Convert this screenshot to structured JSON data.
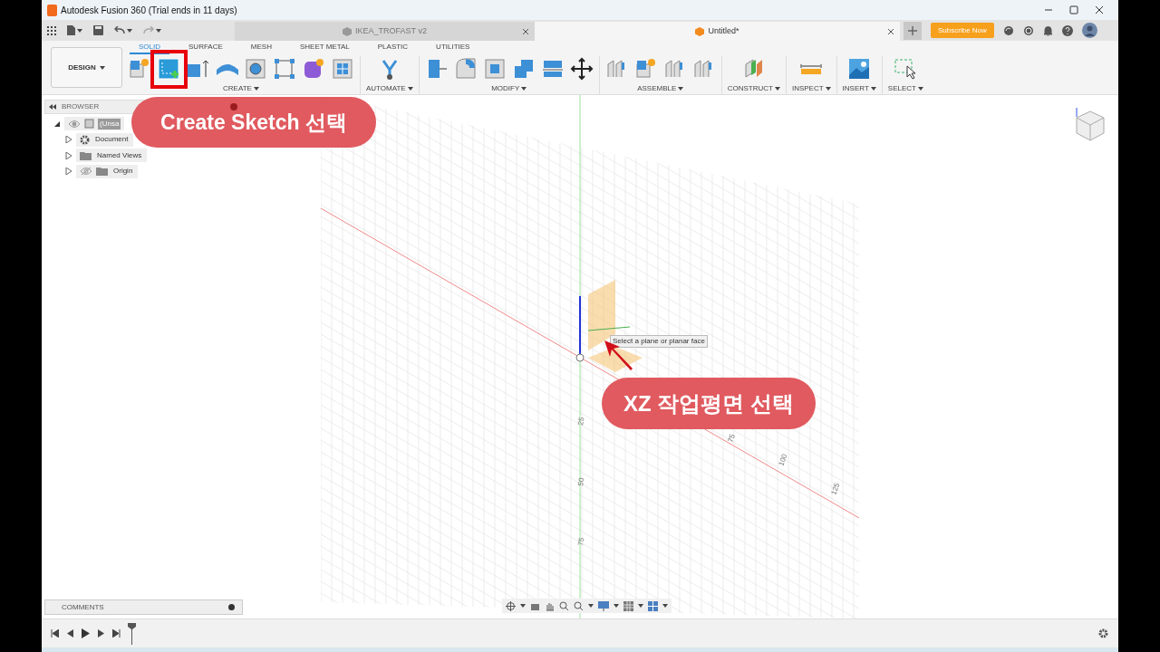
{
  "window": {
    "title": "Autodesk Fusion 360 (Trial ends in 11 days)"
  },
  "doc_tabs": [
    {
      "label": "IKEA_TROFAST v2",
      "selected": false
    },
    {
      "label": "Untitled*",
      "selected": true
    }
  ],
  "subscribe_button": "Subscribe Now",
  "workspace": "DESIGN",
  "toolbar_tabs": [
    {
      "label": "SOLID",
      "selected": true
    },
    {
      "label": "SURFACE",
      "selected": false
    },
    {
      "label": "MESH",
      "selected": false
    },
    {
      "label": "SHEET METAL",
      "selected": false
    },
    {
      "label": "PLASTIC",
      "selected": false
    },
    {
      "label": "UTILITIES",
      "selected": false
    }
  ],
  "tool_groups": [
    {
      "label": "CREATE"
    },
    {
      "label": "AUTOMATE"
    },
    {
      "label": "MODIFY"
    },
    {
      "label": "ASSEMBLE"
    },
    {
      "label": "CONSTRUCT"
    },
    {
      "label": "INSPECT"
    },
    {
      "label": "INSERT"
    },
    {
      "label": "SELECT"
    }
  ],
  "browser": {
    "title": "BROWSER",
    "items": [
      {
        "label": "(Unsa",
        "kind": "component",
        "visible": true,
        "expanded": true,
        "children": [
          {
            "label": "Document",
            "kind": "settings",
            "expanded": false
          },
          {
            "label": "Named Views",
            "kind": "folder",
            "expanded": false
          },
          {
            "label": "Origin",
            "kind": "folder",
            "visible": false,
            "expanded": false
          }
        ]
      }
    ]
  },
  "comments": {
    "title": "COMMENTS"
  },
  "viewport": {
    "tooltip": "Select a plane or planar face",
    "vertical_axis_labels": [
      "25",
      "50",
      "75"
    ],
    "diagonal_axis_labels": [
      "75",
      "100",
      "125"
    ]
  },
  "annotations": [
    {
      "kind": "callout",
      "text": "Create Sketch 선택"
    },
    {
      "kind": "callout",
      "text": "XZ 작업평면 선택"
    }
  ]
}
